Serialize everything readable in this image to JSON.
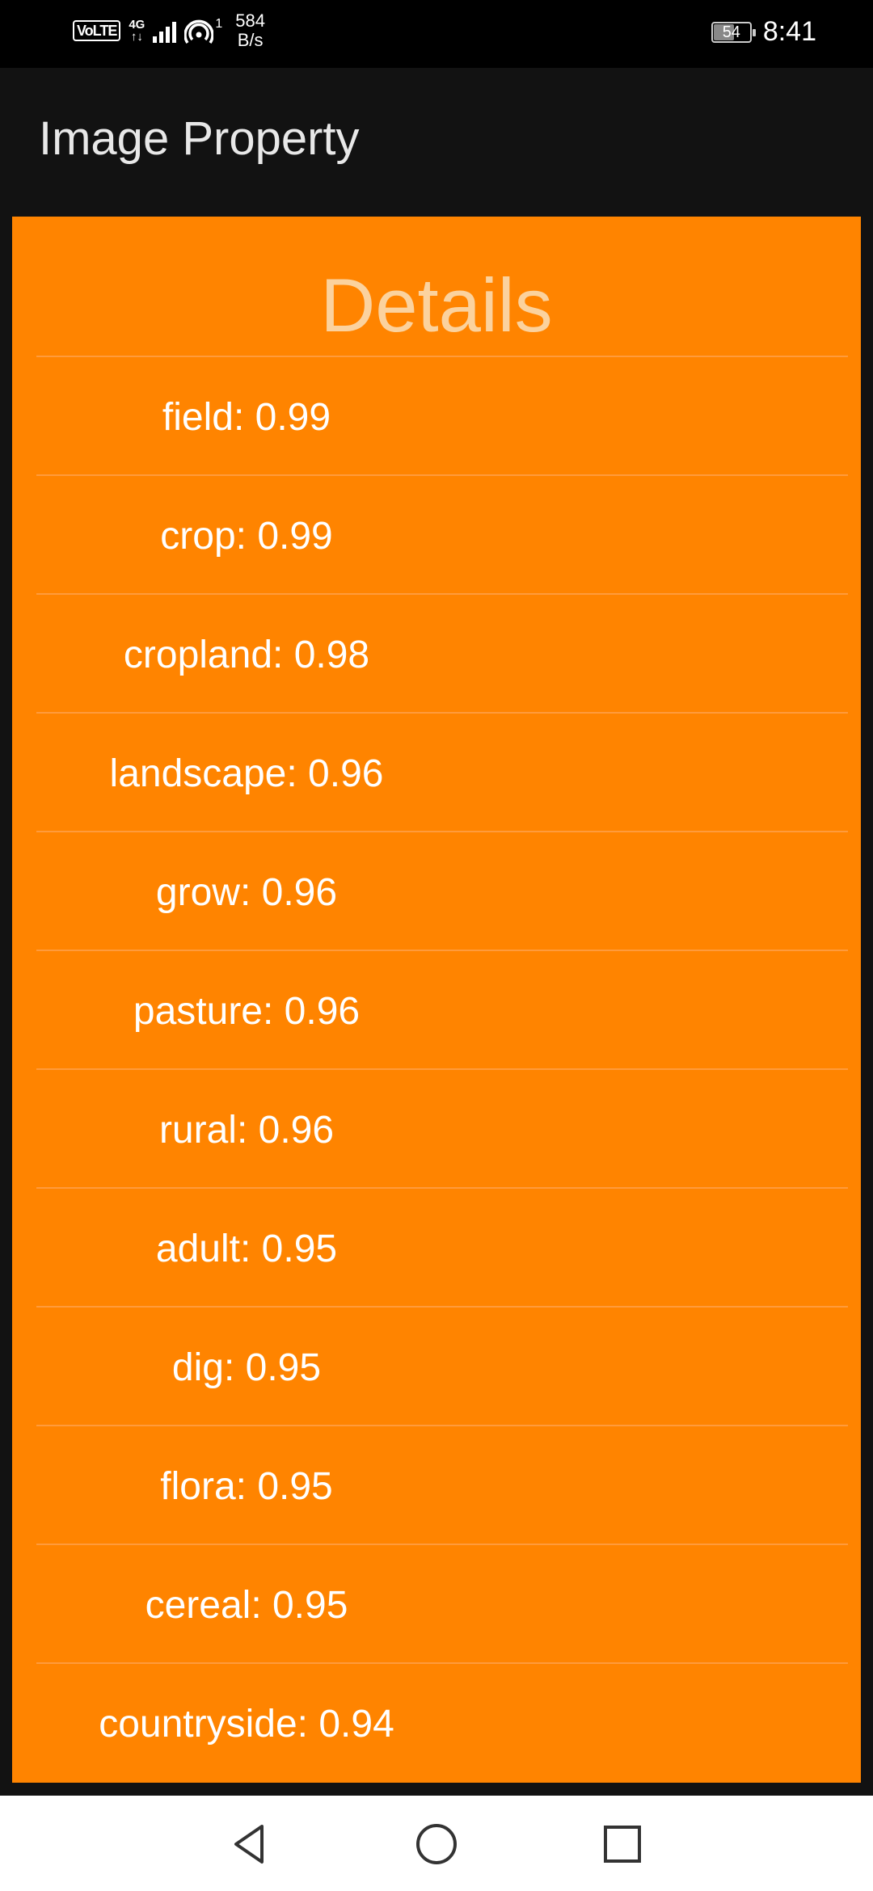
{
  "status_bar": {
    "volte": "VoLTE",
    "network_type": "4G",
    "network_sub": "↑↓",
    "hotspot_count": "1",
    "speed_value": "584",
    "speed_unit": "B/s",
    "battery_level": "54",
    "time": "8:41"
  },
  "app_bar": {
    "title": "Image Property"
  },
  "details": {
    "heading": "Details",
    "items": [
      {
        "label": "field: 0.99"
      },
      {
        "label": "crop: 0.99"
      },
      {
        "label": "cropland: 0.98"
      },
      {
        "label": "landscape: 0.96"
      },
      {
        "label": "grow: 0.96"
      },
      {
        "label": "pasture: 0.96"
      },
      {
        "label": "rural: 0.96"
      },
      {
        "label": "adult: 0.95"
      },
      {
        "label": "dig: 0.95"
      },
      {
        "label": "flora: 0.95"
      },
      {
        "label": "cereal: 0.95"
      },
      {
        "label": "countryside: 0.94"
      }
    ]
  },
  "nav": {
    "back_icon": "triangle-back-icon",
    "home_icon": "circle-home-icon",
    "recent_icon": "square-recents-icon"
  },
  "colors": {
    "card_background": "#ff8400",
    "heading_text": "#fbd29e",
    "app_bar": "#121212",
    "status_bar": "#000000"
  }
}
